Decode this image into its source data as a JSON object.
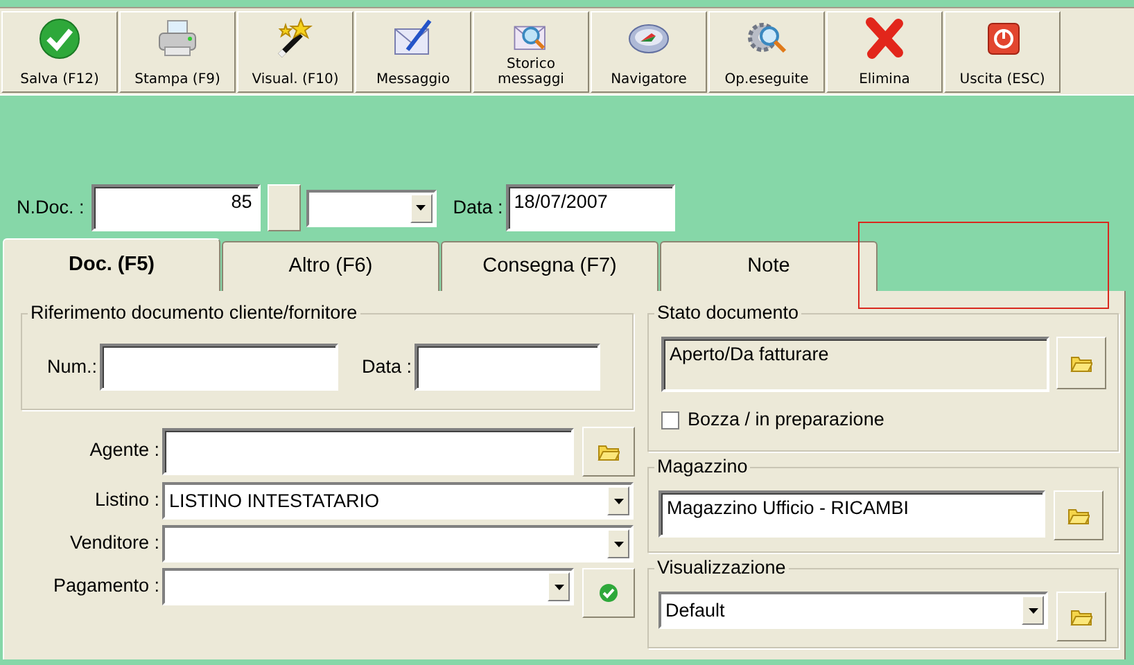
{
  "toolbar": [
    {
      "kind": "save",
      "label": "Salva (F12)"
    },
    {
      "kind": "print",
      "label": "Stampa (F9)"
    },
    {
      "kind": "wand",
      "label": "Visual. (F10)"
    },
    {
      "kind": "message",
      "label": "Messaggio"
    },
    {
      "kind": "history",
      "label": "Storico messaggi"
    },
    {
      "kind": "navigator",
      "label": "Navigatore"
    },
    {
      "kind": "operations",
      "label": "Op.eseguite"
    },
    {
      "kind": "delete",
      "label": "Elimina"
    },
    {
      "kind": "exit",
      "label": "Uscita (ESC)"
    }
  ],
  "header": {
    "doc_label": "N.Doc. :",
    "doc_number": "85",
    "date_label": "Data :",
    "date": "18/07/2007"
  },
  "tabs": [
    {
      "label": "Doc. (F5)",
      "selected": true
    },
    {
      "label": "Altro (F6)",
      "selected": false
    },
    {
      "label": "Consegna (F7)",
      "selected": false
    },
    {
      "label": "Note",
      "selected": false
    }
  ],
  "reference": {
    "title": "Riferimento documento cliente/fornitore",
    "num_label": "Num.:",
    "date_label": "Data :"
  },
  "fields": [
    {
      "kind": "lookup",
      "label": "Agente :"
    },
    {
      "kind": "combo",
      "label": "Listino :",
      "value": "LISTINO INTESTATARIO"
    },
    {
      "kind": "combo",
      "label": "Venditore :"
    },
    {
      "kind": "confirm",
      "label": "Pagamento :"
    }
  ],
  "status": {
    "title": "Stato documento",
    "value": "Aperto/Da fatturare",
    "draft_label": "Bozza / in preparazione",
    "draft_checked": false
  },
  "warehouse": {
    "title": "Magazzino",
    "value": "Magazzino Ufficio - RICAMBI"
  },
  "view": {
    "title": "Visualizzazione",
    "value": "Default"
  }
}
